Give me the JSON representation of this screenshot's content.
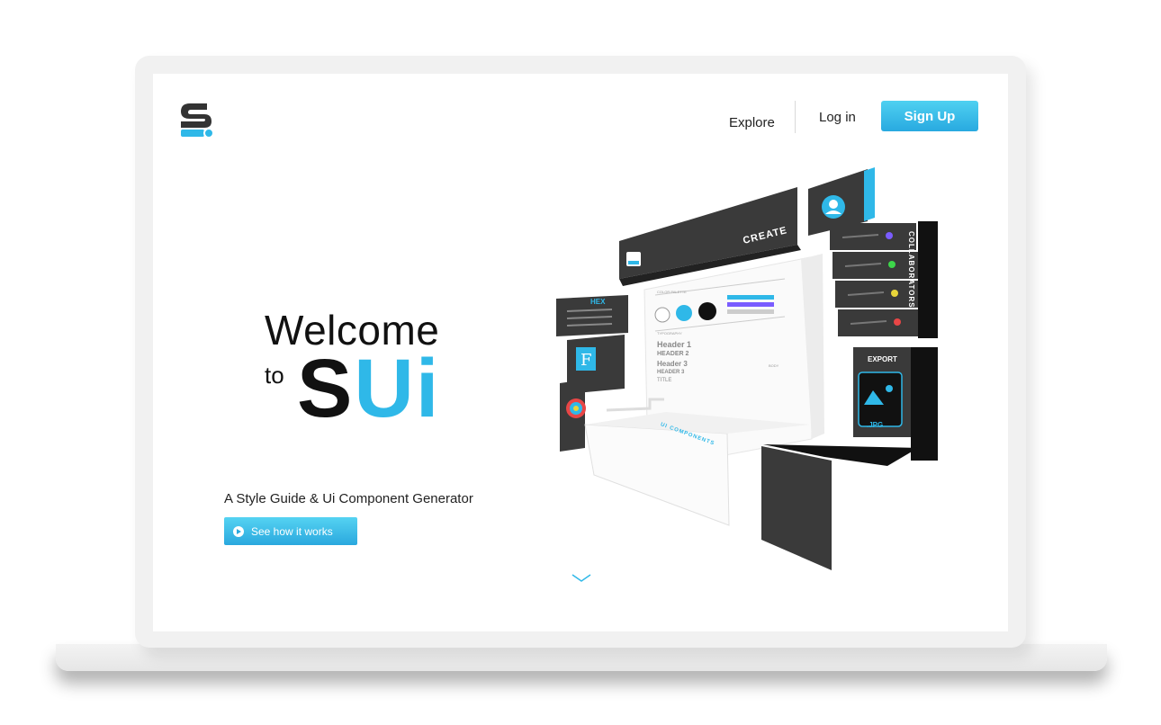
{
  "nav": {
    "explore": "Explore",
    "login": "Log in",
    "signup": "Sign Up"
  },
  "hero": {
    "welcome": "Welcome",
    "to": "to",
    "brand_s": "S",
    "brand_ui": "Ui",
    "tagline": "A Style Guide & Ui Component Generator",
    "cta": "See how it works"
  },
  "illustration": {
    "hex": "HEX",
    "create": "CREATE",
    "collaborators": "COLLABORATORS",
    "export": "EXPORT",
    "jpg": ".JPG",
    "ui_components": "UI COMPONENTS",
    "color_palette": "COLOR PALETTE",
    "typography": "TYPOGRAPHY",
    "header1": "Header 1",
    "header2": "HEADER 2",
    "header3a": "Header 3",
    "header3b": "HEADER 3",
    "title": "TITLE",
    "body": "BODY"
  },
  "colors": {
    "accent": "#2fb8e8",
    "dark": "#333333",
    "collab_avatars": [
      "#7a5cff",
      "#3dd64a",
      "#e7d43a",
      "#e84646"
    ]
  },
  "icons": {
    "logo": "sui-logo-icon",
    "play": "play-icon",
    "chevron": "chevron-down-icon"
  }
}
